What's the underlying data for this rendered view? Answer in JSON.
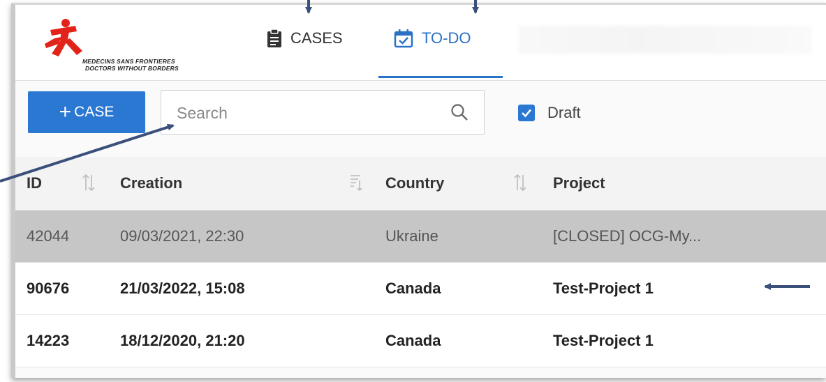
{
  "brand": {
    "line1": "MEDECINS SANS FRONTIERES",
    "line2": "DOCTORS WITHOUT BORDERS",
    "color": "#e2231a"
  },
  "nav": {
    "tabs": [
      {
        "label": "CASES",
        "icon": "clipboard-icon",
        "active": false
      },
      {
        "label": "TO-DO",
        "icon": "calendar-check-icon",
        "active": true
      }
    ]
  },
  "toolbar": {
    "add_case_label": "CASE",
    "add_case_icon": "plus-icon",
    "search_placeholder": "Search",
    "draft_label": "Draft",
    "draft_checked": true
  },
  "table": {
    "columns": [
      "ID",
      "Creation",
      "Country",
      "Project"
    ],
    "rows": [
      {
        "id": "42044",
        "creation": "09/03/2021, 22:30",
        "country": "Ukraine",
        "project": "[CLOSED] OCG-My..."
      },
      {
        "id": "90676",
        "creation": "21/03/2022, 15:08",
        "country": "Canada",
        "project": "Test-Project 1"
      },
      {
        "id": "14223",
        "creation": "18/12/2020, 21:20",
        "country": "Canada",
        "project": "Test-Project 1"
      }
    ]
  },
  "colors": {
    "accent": "#2b78d2",
    "selected_row": "#c6c6c6",
    "annotation_arrow": "#3a4f7a"
  }
}
